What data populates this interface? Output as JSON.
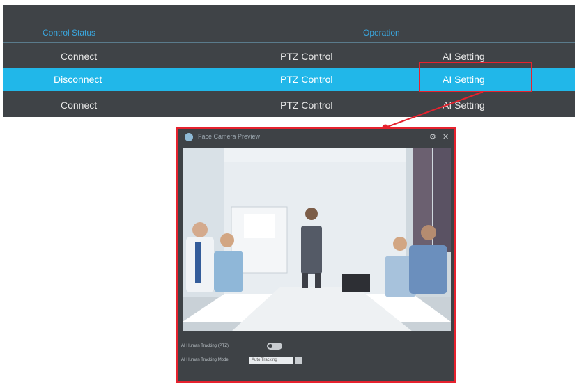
{
  "table": {
    "headers": {
      "control_status": "Control Status",
      "operation": "Operation"
    },
    "rows": [
      {
        "status": "Connect",
        "ptz": "PTZ Control",
        "ai": "AI Setting",
        "selected": false
      },
      {
        "status": "Disconnect",
        "ptz": "PTZ Control",
        "ai": "AI Setting",
        "selected": true
      },
      {
        "status": "Connect",
        "ptz": "PTZ Control",
        "ai": "AI Setting",
        "selected": false
      }
    ]
  },
  "dialog": {
    "title": "Face Camera Preview",
    "gear_glyph": "⚙",
    "close_glyph": "✕",
    "fields": {
      "tracking_label": "AI Human Tracking (PTZ)",
      "mode_label": "AI Human Tracking Mode",
      "mode_value": "Auto Tracking"
    }
  },
  "colors": {
    "accent": "#21b7e9",
    "highlight": "#e6222e",
    "panel": "#3f4347"
  }
}
